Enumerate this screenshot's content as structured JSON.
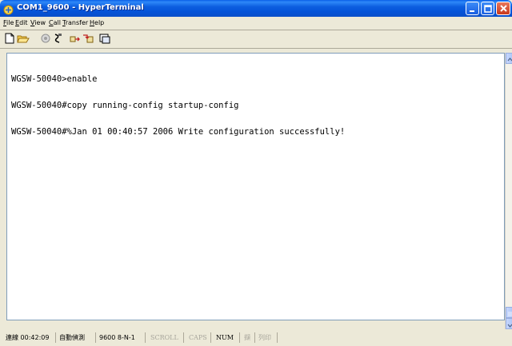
{
  "window": {
    "title": "COM1_9600 - HyperTerminal",
    "colors": {
      "titlebar": "#0A5FE8",
      "close_button": "#D34B2B",
      "terminal_bg": "#FFFFFF",
      "chrome": "#ECE9D8"
    }
  },
  "menu": [
    {
      "label": "File"
    },
    {
      "label": "Edit"
    },
    {
      "label": "View"
    },
    {
      "label": "Call"
    },
    {
      "label": "Transfer"
    },
    {
      "label": "Help"
    }
  ],
  "toolbar": {
    "buttons": [
      {
        "icon": "new-document-icon"
      },
      {
        "icon": "open-folder-icon"
      },
      {
        "icon": "call-icon"
      },
      {
        "icon": "disconnect-icon"
      },
      {
        "icon": "send-icon"
      },
      {
        "icon": "receive-icon"
      },
      {
        "icon": "properties-icon"
      }
    ]
  },
  "terminal": {
    "lines": [
      "WGSW-50040>enable",
      "WGSW-50040#copy running-config startup-config",
      "WGSW-50040#%Jan 01 00:40:57 2006 Write configuration successfully!"
    ]
  },
  "status": {
    "connected": "連線 00:42:09",
    "detect": "自動偵測",
    "port": "9600 8-N-1",
    "scroll": "SCROLL",
    "caps": "CAPS",
    "num": "NUM",
    "capture": "擷",
    "print_echo": "列印"
  }
}
